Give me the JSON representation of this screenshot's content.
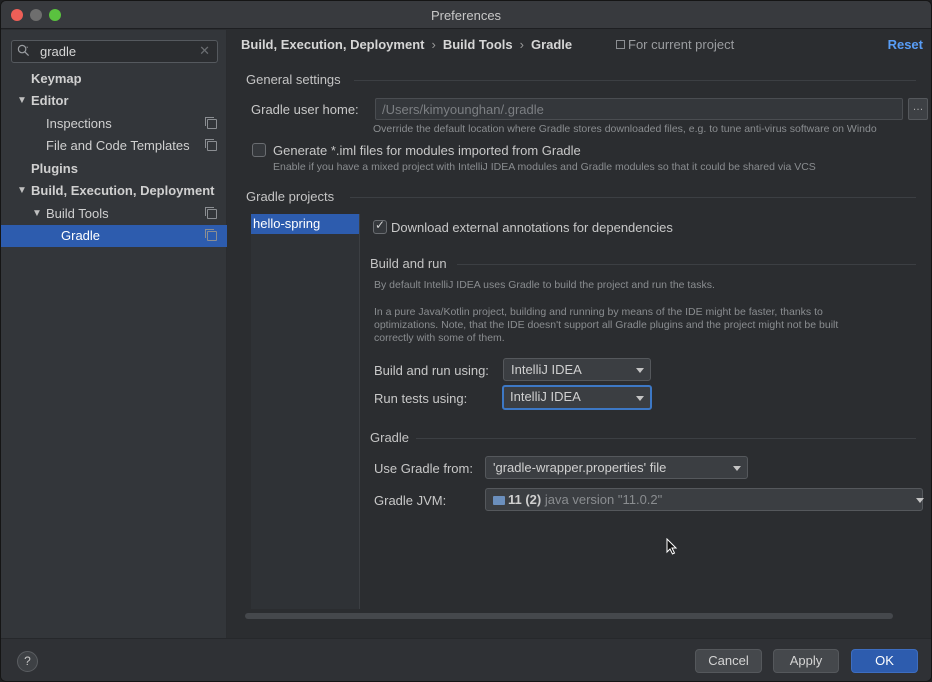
{
  "window": {
    "title": "Preferences"
  },
  "sidebar": {
    "search_value": "gradle",
    "items": [
      {
        "label": "Keymap"
      },
      {
        "label": "Editor"
      },
      {
        "label": "Inspections"
      },
      {
        "label": "File and Code Templates"
      },
      {
        "label": "Plugins"
      },
      {
        "label": "Build, Execution, Deployment"
      },
      {
        "label": "Build Tools"
      },
      {
        "label": "Gradle"
      }
    ]
  },
  "header": {
    "breadcrumb": [
      "Build, Execution, Deployment",
      "Build Tools",
      "Gradle"
    ],
    "scope": "For current project",
    "reset": "Reset"
  },
  "general": {
    "title": "General settings",
    "user_home_label": "Gradle user home:",
    "user_home_value": "/Users/kimyounghan/.gradle",
    "user_home_hint": "Override the default location where Gradle stores downloaded files, e.g. to tune anti-virus software on Windo",
    "generate_iml_label": "Generate *.iml files for modules imported from Gradle",
    "generate_iml_hint": "Enable if you have a mixed project with IntelliJ IDEA modules and Gradle modules so that it could be shared via VCS",
    "generate_iml_checked": false
  },
  "projects": {
    "title": "Gradle projects",
    "items": [
      "hello-spring"
    ],
    "download_annotations_label": "Download external annotations for dependencies",
    "download_annotations_checked": true
  },
  "build_run": {
    "title": "Build and run",
    "hint1": "By default IntelliJ IDEA uses Gradle to build the project and run the tasks.",
    "hint2_line1": "In a pure Java/Kotlin project, building and running by means of the IDE might be faster, thanks to",
    "hint2_line2": "optimizations. Note, that the IDE doesn't support all Gradle plugins and the project might not be built",
    "hint2_line3": "correctly with some of them.",
    "build_using_label": "Build and run using:",
    "build_using_value": "IntelliJ IDEA",
    "tests_using_label": "Run tests using:",
    "tests_using_value": "IntelliJ IDEA"
  },
  "gradle": {
    "title": "Gradle",
    "use_from_label": "Use Gradle from:",
    "use_from_value": "'gradle-wrapper.properties' file",
    "jvm_label": "Gradle JVM:",
    "jvm_name": "11 (2)",
    "jvm_version": "java version \"11.0.2\""
  },
  "footer": {
    "help": "?",
    "cancel": "Cancel",
    "apply": "Apply",
    "ok": "OK"
  },
  "colors": {
    "accent": "#2d5cae",
    "link": "#589df6",
    "background": "#2b2d30"
  }
}
